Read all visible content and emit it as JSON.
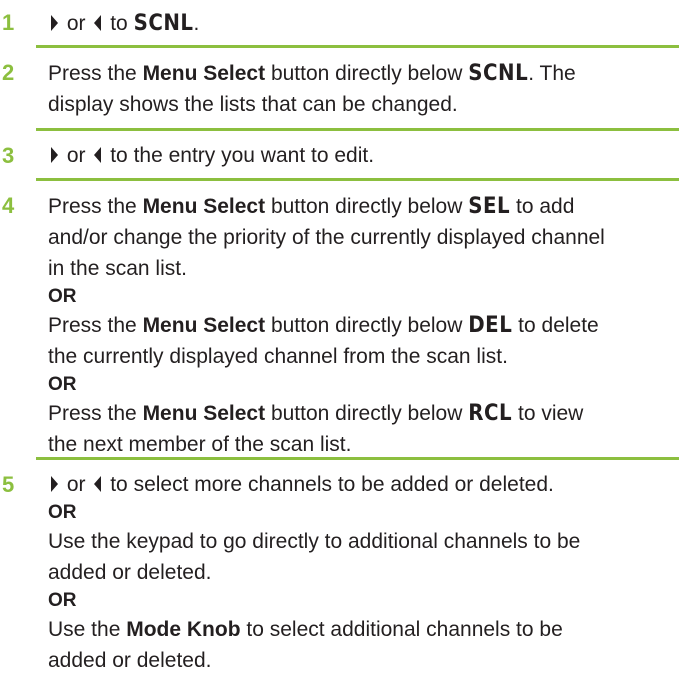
{
  "steps": [
    {
      "number": "1",
      "p1": "or",
      "p2": "to",
      "d1": "SCNL",
      "p3": "."
    },
    {
      "number": "2",
      "l1a": "Press the",
      "l1b": "Menu Select",
      "l1c": "button directly below",
      "l1d": "SCNL",
      "l1e": ". The",
      "l2": "display shows the lists that can be changed."
    },
    {
      "number": "3",
      "p1": "or",
      "p2": "to the entry you want to edit."
    },
    {
      "number": "4",
      "a1a": "Press the",
      "a1b": "Menu Select",
      "a1c": "button directly below",
      "a1d": "SEL",
      "a1e": "to add",
      "a2": "and/or change the priority of the currently displayed channel",
      "a3": "in the scan list.",
      "or1": "OR",
      "b1a": "Press the",
      "b1b": "Menu Select",
      "b1c": "button directly below",
      "b1d": "DEL",
      "b1e": "to delete",
      "b2": "the currently displayed channel from the scan list.",
      "or2": "OR",
      "c1a": "Press the",
      "c1b": "Menu Select",
      "c1c": "button directly below",
      "c1d": "RCL",
      "c1e": "to view",
      "c2": "the next member of the scan list."
    },
    {
      "number": "5",
      "p1": "or",
      "p2": "to select more channels to be added or deleted.",
      "or1": "OR",
      "k1": "Use the keypad to go directly to additional channels to be",
      "k2": "added or deleted.",
      "or2": "OR",
      "m1a": "Use the",
      "m1b": "Mode Knob",
      "m1c": "to select additional channels to be",
      "m2": "added or deleted."
    }
  ],
  "icons": {
    "right": "right-arrow-icon",
    "left": "left-arrow-icon"
  },
  "colors": {
    "accent": "#8cbf3f",
    "text": "#231f20"
  }
}
